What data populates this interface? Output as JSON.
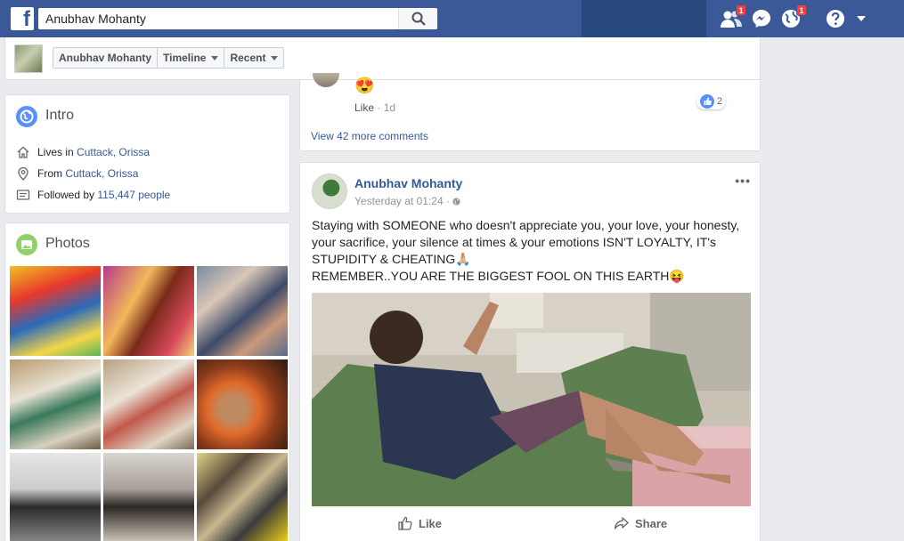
{
  "topbar": {
    "logo": "f",
    "search_value": "Anubhav Mohanty",
    "friend_requests_count": "1",
    "notifications_count": "1"
  },
  "subheader": {
    "profile_name": "Anubhav Mohanty",
    "timeline_label": "Timeline",
    "recent_label": "Recent"
  },
  "intro": {
    "title": "Intro",
    "lives_prefix": "Lives in ",
    "lives_place": "Cuttack, Orissa",
    "from_prefix": "From ",
    "from_place": "Cuttack, Orissa",
    "followed_prefix": "Followed by ",
    "followed_count": "115,447 people"
  },
  "photos": {
    "title": "Photos"
  },
  "comment": {
    "emoji": "😍",
    "like_label": "Like",
    "separator": "·",
    "age": "1d",
    "reactions_count": "2",
    "more_comments": "View 42 more comments"
  },
  "post": {
    "author": "Anubhav Mohanty",
    "time": "Yesterday at 01:24 · ",
    "lines": [
      "Staying with SOMEONE who doesn't appreciate you, your love, your honesty,",
      "your sacrifice, your silence at times & your emotions ISN'T LOYALTY, IT's",
      "STUPIDITY & CHEATING🙏🏼",
      "REMEMBER..YOU ARE THE BIGGEST FOOL ON THIS EARTH😝"
    ],
    "like_label": "Like",
    "share_label": "Share"
  },
  "colors": {
    "brand": "#3b5998",
    "brand_dark": "#29487d",
    "link": "#365899",
    "badge": "#fa3e3e"
  }
}
